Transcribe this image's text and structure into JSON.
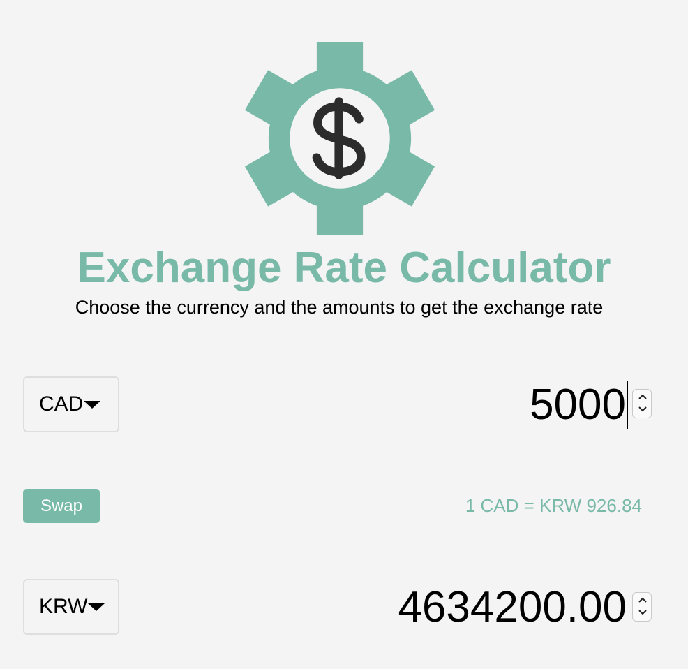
{
  "app": {
    "title": "Exchange Rate Calculator",
    "subtitle": "Choose the currency and the amounts to get the exchange rate",
    "logo_icon": "gear-dollar-icon"
  },
  "colors": {
    "accent": "#78b9a8",
    "background": "#f4f4f4",
    "text": "#000000"
  },
  "from": {
    "currency": "CAD",
    "amount": "5000"
  },
  "to": {
    "currency": "KRW",
    "amount": "4634200.00"
  },
  "swap": {
    "label": "Swap"
  },
  "rate": {
    "text": "1 CAD = KRW 926.84"
  }
}
